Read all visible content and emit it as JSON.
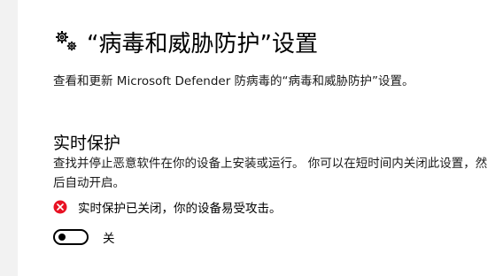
{
  "header": {
    "icon": "virus-threat-protection-gears-icon",
    "title": "“病毒和威胁防护”设置"
  },
  "description": "查看和更新 Microsoft Defender 防病毒的“病毒和威胁防护”设置。",
  "realtime": {
    "title": "实时保护",
    "description": "查找并停止恶意软件在你的设备上安装或运行。 你可以在短时间内关闭此设置，然后自动开启。",
    "warning_icon": "error-x-icon",
    "warning_color": "#e81123",
    "warning_text": "实时保护已关闭，你的设备易受攻击。",
    "toggle_state": "off",
    "toggle_label": "关"
  }
}
